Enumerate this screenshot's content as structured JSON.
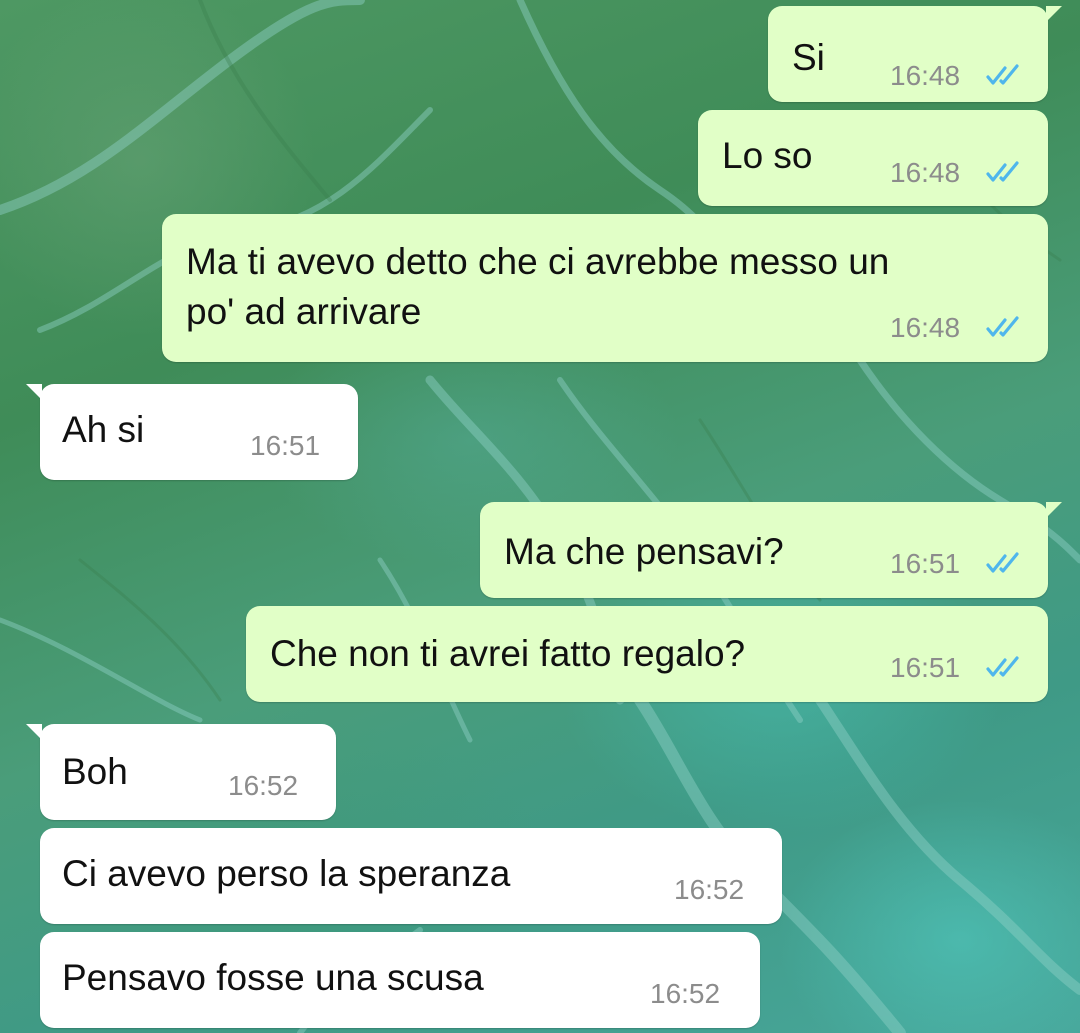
{
  "chat": {
    "tick_color": "#4fb6ec",
    "outgoing_bubble_color": "#e1ffc7",
    "incoming_bubble_color": "#ffffff",
    "messages": [
      {
        "direction": "outgoing",
        "lines": [
          "Si"
        ],
        "time": "16:48",
        "status": "read"
      },
      {
        "direction": "outgoing",
        "lines": [
          "Lo so"
        ],
        "time": "16:48",
        "status": "read"
      },
      {
        "direction": "outgoing",
        "lines": [
          "Ma ti avevo detto che ci avrebbe messo un",
          "po' ad arrivare"
        ],
        "time": "16:48",
        "status": "read"
      },
      {
        "direction": "incoming",
        "lines": [
          "Ah si"
        ],
        "time": "16:51"
      },
      {
        "direction": "outgoing",
        "lines": [
          "Ma che pensavi?"
        ],
        "time": "16:51",
        "status": "read"
      },
      {
        "direction": "outgoing",
        "lines": [
          "Che non ti avrei fatto regalo?"
        ],
        "time": "16:51",
        "status": "read"
      },
      {
        "direction": "incoming",
        "lines": [
          "Boh"
        ],
        "time": "16:52"
      },
      {
        "direction": "incoming",
        "lines": [
          "Ci avevo perso la speranza"
        ],
        "time": "16:52"
      },
      {
        "direction": "incoming",
        "lines": [
          "Pensavo fosse una scusa"
        ],
        "time": "16:52"
      }
    ]
  }
}
